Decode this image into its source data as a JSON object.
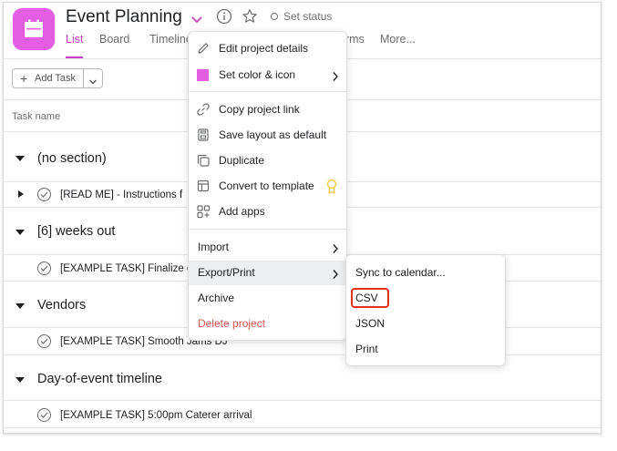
{
  "header": {
    "title": "Event Planning",
    "set_status": "Set status",
    "tabs": [
      {
        "label": "List",
        "active": true
      },
      {
        "label": "Board"
      },
      {
        "label": "Timeline"
      },
      {
        "label": "rms"
      },
      {
        "label": "More..."
      }
    ],
    "accent_color": "#c341c3",
    "project_icon_color": "#e35ee3"
  },
  "toolbar": {
    "add_task_label": "Add Task"
  },
  "list": {
    "column_header": "Task name",
    "sections": [
      {
        "title": "(no section)",
        "tasks": [
          {
            "text": "[READ ME] - Instructions f",
            "has_subtasks": true
          }
        ]
      },
      {
        "title": "[6] weeks out",
        "tasks": [
          {
            "text": "[EXAMPLE TASK] Finalize e"
          }
        ]
      },
      {
        "title": "Vendors",
        "tasks": [
          {
            "text": "[EXAMPLE TASK] Smooth Jams DJ"
          }
        ]
      },
      {
        "title": "Day-of-event timeline",
        "tasks": [
          {
            "text": "[EXAMPLE TASK] 5:00pm Caterer arrival"
          }
        ]
      }
    ]
  },
  "project_menu": {
    "items": [
      {
        "label": "Edit project details",
        "icon": "pencil-icon"
      },
      {
        "label": "Set color & icon",
        "icon": "color-swatch",
        "submenu": true
      },
      {
        "label": "Copy project link",
        "icon": "link-icon"
      },
      {
        "label": "Save layout as default",
        "icon": "layout-icon"
      },
      {
        "label": "Duplicate",
        "icon": "duplicate-icon"
      },
      {
        "label": "Convert to template",
        "icon": "template-icon",
        "badge_icon": "award-icon"
      },
      {
        "label": "Add apps",
        "icon": "apps-icon"
      },
      {
        "label": "Import",
        "submenu": true
      },
      {
        "label": "Export/Print",
        "submenu": true,
        "highlighted": true
      },
      {
        "label": "Archive"
      },
      {
        "label": "Delete project",
        "danger": true
      }
    ]
  },
  "export_submenu": {
    "items": [
      {
        "label": "Sync to calendar..."
      },
      {
        "label": "CSV",
        "highlighted_annotation": true
      },
      {
        "label": "JSON"
      },
      {
        "label": "Print"
      }
    ]
  }
}
